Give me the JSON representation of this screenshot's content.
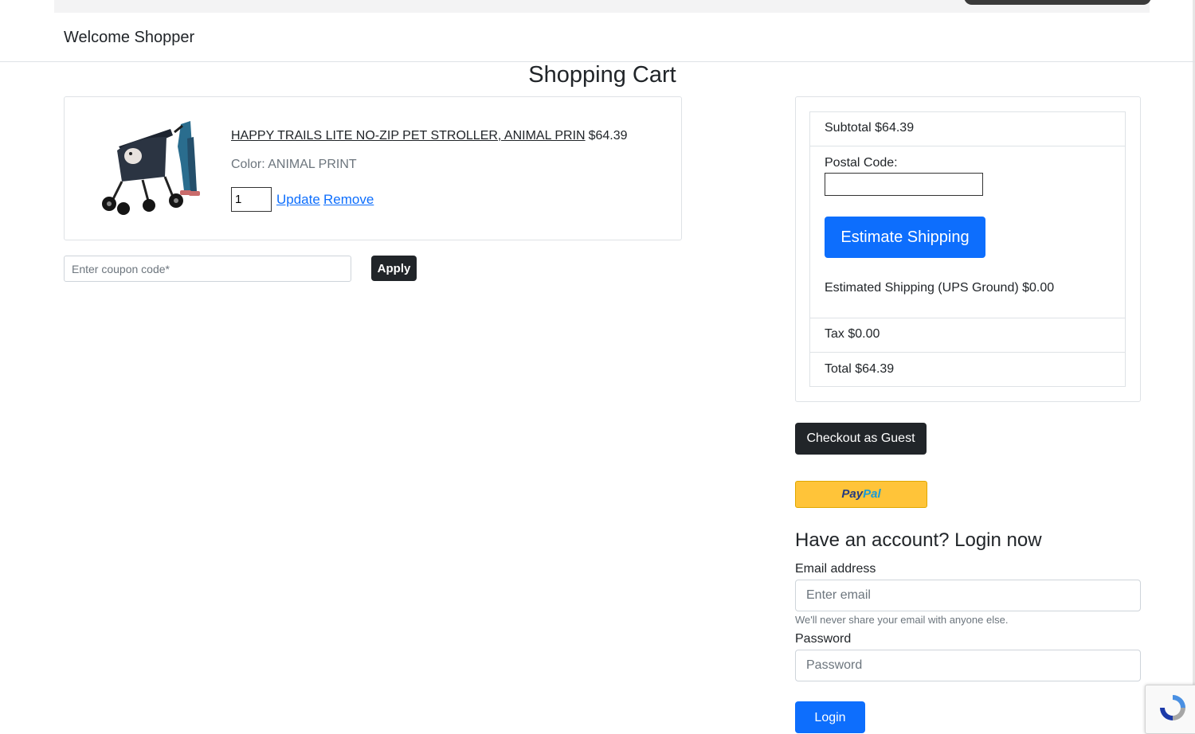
{
  "navbar": {
    "welcome_text": "Welcome Shopper"
  },
  "page": {
    "title": "Shopping Cart"
  },
  "cart": {
    "items": [
      {
        "name": "HAPPY TRAILS LITE NO-ZIP PET STROLLER, ANIMAL PRIN",
        "price": "$64.39",
        "color_text": "Color: ANIMAL PRINT",
        "quantity": "1",
        "update_label": "Update",
        "remove_label": "Remove"
      }
    ],
    "coupon_placeholder": "Enter coupon code*",
    "apply_label": "Apply"
  },
  "summary": {
    "subtotal_text": "Subtotal $64.39",
    "postal_label": "Postal Code:",
    "postal_value": "",
    "estimate_label": "Estimate Shipping",
    "estimated_shipping_text": "Estimated Shipping (UPS Ground)  $0.00",
    "tax_text": "Tax $0.00",
    "total_text": "Total $64.39"
  },
  "checkout": {
    "guest_label": "Checkout as Guest",
    "paypal_part1": "Pay",
    "paypal_part2": "Pal"
  },
  "login": {
    "heading": "Have an account? Login now",
    "email_label": "Email address",
    "email_placeholder": "Enter email",
    "email_help": "We'll never share your email with anyone else.",
    "password_label": "Password",
    "password_placeholder": "Password",
    "button_label": "Login"
  },
  "colors": {
    "primary": "#0d6efd",
    "dark": "#212529",
    "paypal_yellow": "#ffc439"
  }
}
